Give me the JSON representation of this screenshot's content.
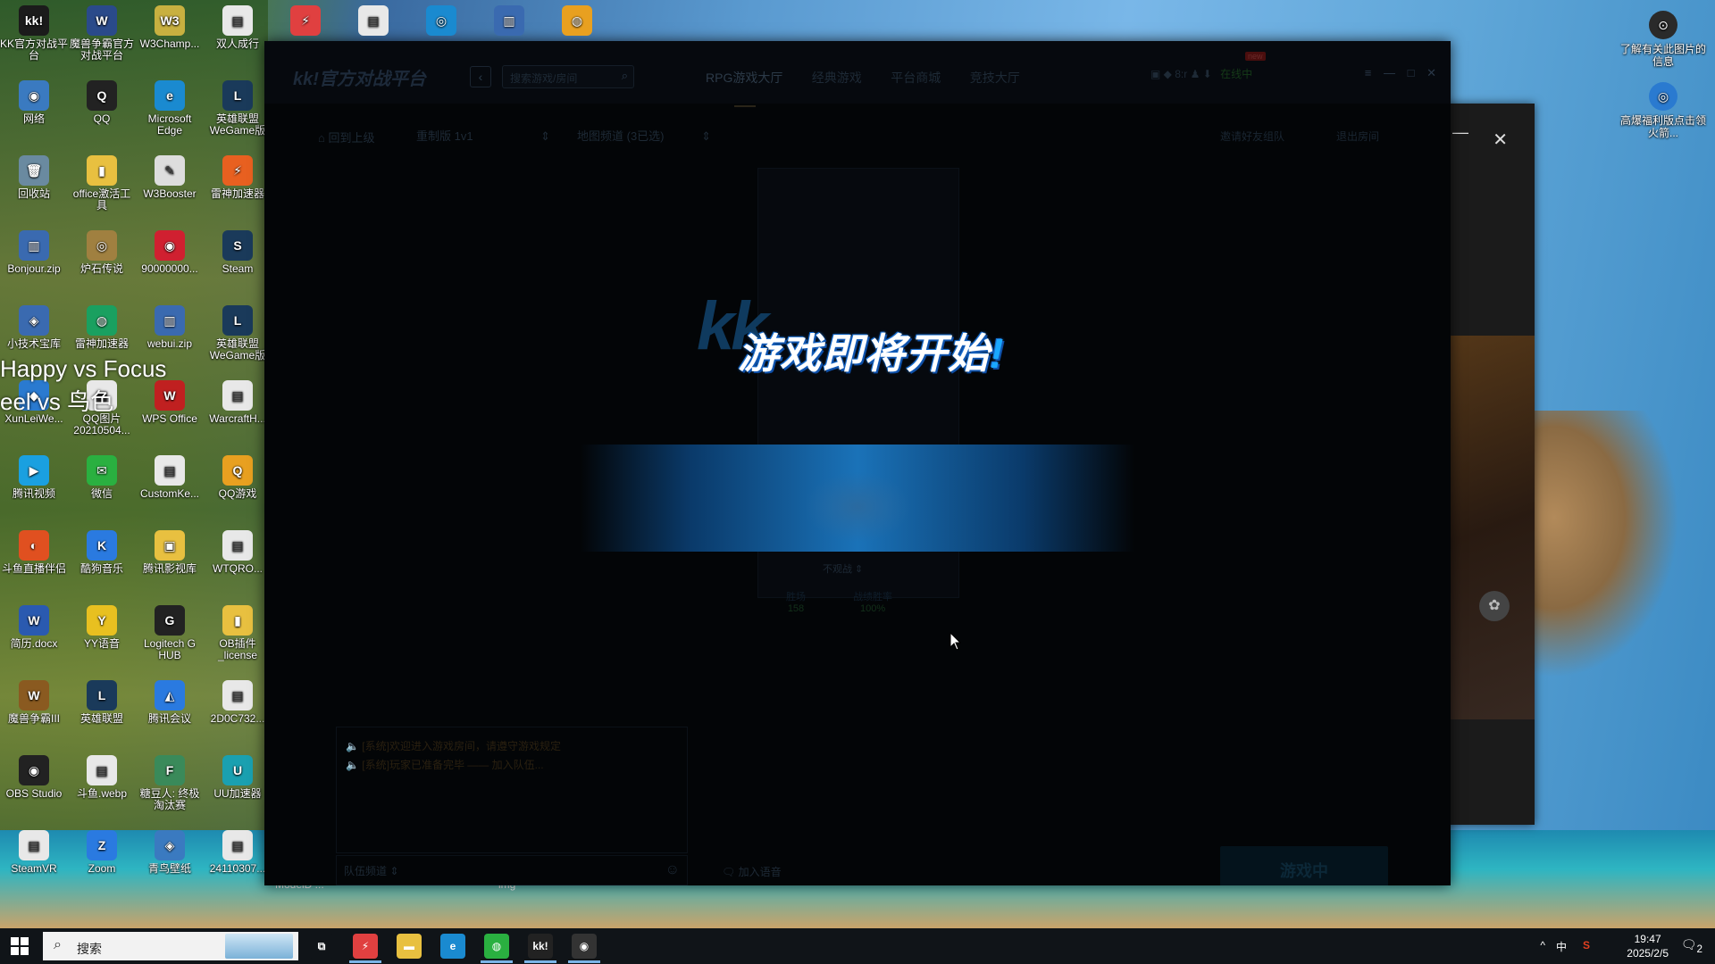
{
  "desktop_icons": [
    {
      "label": "KK官方对战平台",
      "glyph": "kk!",
      "color": "#1b1b1b"
    },
    {
      "label": "魔兽争霸官方对战平台",
      "glyph": "W",
      "color": "#2a4a8a"
    },
    {
      "label": "W3Champ...",
      "glyph": "W3",
      "color": "#c8b040"
    },
    {
      "label": "双人成行",
      "glyph": "▤",
      "color": "#e8e8e8"
    },
    {
      "label": "网络",
      "glyph": "◉",
      "color": "#3a7ac0"
    },
    {
      "label": "QQ",
      "glyph": "Q",
      "color": "#222"
    },
    {
      "label": "Microsoft Edge",
      "glyph": "e",
      "color": "#1a8ad0"
    },
    {
      "label": "英雄联盟WeGame版",
      "glyph": "L",
      "color": "#1a3a5a"
    },
    {
      "label": "回收站",
      "glyph": "🗑",
      "color": "#6a8aa0"
    },
    {
      "label": "office激活工具",
      "glyph": "▮",
      "color": "#e8c040"
    },
    {
      "label": "W3Booster",
      "glyph": "✎",
      "color": "#dddddd"
    },
    {
      "label": "雷神加速器",
      "glyph": "⚡",
      "color": "#e86020"
    },
    {
      "label": "Bonjour.zip",
      "glyph": "▥",
      "color": "#3a6ab0"
    },
    {
      "label": "炉石传说",
      "glyph": "◎",
      "color": "#a08040"
    },
    {
      "label": "90000000...",
      "glyph": "◉",
      "color": "#d02030"
    },
    {
      "label": "Steam",
      "glyph": "S",
      "color": "#1a3a5a"
    },
    {
      "label": "小技术宝库",
      "glyph": "◈",
      "color": "#3a6ab0"
    },
    {
      "label": "雷神加速器",
      "glyph": "◍",
      "color": "#1aa060"
    },
    {
      "label": "webui.zip",
      "glyph": "▥",
      "color": "#3a6ab0"
    },
    {
      "label": "英雄联盟WeGame版",
      "glyph": "L",
      "color": "#1a3a5a"
    },
    {
      "label": "XunLeiWe...",
      "glyph": "◆",
      "color": "#2a7ad0"
    },
    {
      "label": "QQ图片20210504...",
      "glyph": "▦",
      "color": "#e8e8e8"
    },
    {
      "label": "WPS Office",
      "glyph": "W",
      "color": "#c02020"
    },
    {
      "label": "WarcraftH...",
      "glyph": "▤",
      "color": "#e8e8e8"
    },
    {
      "label": "腾讯视频",
      "glyph": "▶",
      "color": "#1aa0e0"
    },
    {
      "label": "微信",
      "glyph": "✉",
      "color": "#2ab040"
    },
    {
      "label": "CustomKe...",
      "glyph": "▤",
      "color": "#e8e8e8"
    },
    {
      "label": "QQ游戏",
      "glyph": "Q",
      "color": "#e8a020"
    },
    {
      "label": "斗鱼直播伴侣",
      "glyph": "◐",
      "color": "#e05020"
    },
    {
      "label": "酷狗音乐",
      "glyph": "K",
      "color": "#2a7ae0"
    },
    {
      "label": "腾讯影视库",
      "glyph": "▣",
      "color": "#e8c040"
    },
    {
      "label": "WTQRO...",
      "glyph": "▤",
      "color": "#e8e8e8"
    },
    {
      "label": "简历.docx",
      "glyph": "W",
      "color": "#2a5ab0"
    },
    {
      "label": "YY语音",
      "glyph": "Y",
      "color": "#e8c020"
    },
    {
      "label": "Logitech G HUB",
      "glyph": "G",
      "color": "#222"
    },
    {
      "label": "OB插件_license",
      "glyph": "▮",
      "color": "#e8c040"
    },
    {
      "label": "魔兽争霸III",
      "glyph": "W",
      "color": "#8a5a20"
    },
    {
      "label": "英雄联盟",
      "glyph": "L",
      "color": "#1a3a5a"
    },
    {
      "label": "腾讯会议",
      "glyph": "◭",
      "color": "#2a7ae0"
    },
    {
      "label": "2D0C732...",
      "glyph": "▤",
      "color": "#e8e8e8"
    },
    {
      "label": "OBS Studio",
      "glyph": "◉",
      "color": "#222"
    },
    {
      "label": "斗鱼.webp",
      "glyph": "▤",
      "color": "#e8e8e8"
    },
    {
      "label": "糖豆人: 终极淘汰赛",
      "glyph": "F",
      "color": "#3a8a5a"
    },
    {
      "label": "UU加速器",
      "glyph": "U",
      "color": "#1aa0b0"
    },
    {
      "label": "SteamVR",
      "glyph": "▤",
      "color": "#e8e8e8"
    },
    {
      "label": "Zoom",
      "glyph": "Z",
      "color": "#2a7ae0"
    },
    {
      "label": "青鸟壁纸",
      "glyph": "◈",
      "color": "#3a7ac0"
    },
    {
      "label": "24110307...",
      "glyph": "▤",
      "color": "#e8e8e8"
    }
  ],
  "top_icons": [
    {
      "glyph": "⚡",
      "color": "#e04040"
    },
    {
      "glyph": "▤",
      "color": "#e8e8e8"
    },
    {
      "glyph": "◎",
      "color": "#1a8ad0"
    },
    {
      "glyph": "▥",
      "color": "#3a6ab0"
    },
    {
      "glyph": "◍",
      "color": "#e8a020"
    }
  ],
  "right_icons": [
    {
      "label": "了解有关此图片的信息",
      "glyph": "⊙"
    },
    {
      "label": "高爆福利版点击领火箭...",
      "glyph": "◎"
    }
  ],
  "overlay_text": {
    "happy": "Happy vs Focus",
    "eel": "eel vs 鸟色",
    "bottom_left": "ModelD ...",
    "bottom_mid": "img"
  },
  "kk_window": {
    "logo": "kk!官方对战平台",
    "search_placeholder": "搜索游戏/房间",
    "nav": [
      "RPG游戏大厅",
      "经典游戏",
      "平台商城",
      "竞技大厅"
    ],
    "user_status": "在线中",
    "new_badge": "new",
    "crumb": "回到上级",
    "mode_select": "重制版 1v1",
    "map_select": "地图频道 (3已选)",
    "right_buttons": [
      "邀请好友组队",
      "退出房间"
    ],
    "slot_dropdown": "不观战",
    "stats": [
      {
        "label": "胜场",
        "value": "158"
      },
      {
        "label": "战绩胜率",
        "value": "100%"
      }
    ],
    "chat_messages": [
      "[系统]欢迎进入游戏房间，请遵守游戏规定",
      "[系统]玩家已准备完毕 —— 加入队伍..."
    ],
    "chat_channel": "队伍频道",
    "voice": "加入语音",
    "playing_button": "游戏中",
    "splash_logo": "kk",
    "splash_text": "游戏即将开始",
    "splash_bang": "!"
  },
  "taskbar": {
    "search_placeholder": "搜索",
    "apps": [
      {
        "name": "task-view",
        "glyph": "⧉",
        "color": "#101418"
      },
      {
        "name": "game",
        "glyph": "⚡",
        "color": "#e04040"
      },
      {
        "name": "file-explorer",
        "glyph": "▬",
        "color": "#e8c040"
      },
      {
        "name": "edge",
        "glyph": "e",
        "color": "#1a8ad0"
      },
      {
        "name": "xbox",
        "glyph": "◍",
        "color": "#2ab040"
      },
      {
        "name": "kk",
        "glyph": "kk!",
        "color": "#222"
      },
      {
        "name": "obs",
        "glyph": "◉",
        "color": "#333"
      }
    ],
    "tray": {
      "ime": "中",
      "chevron": "^",
      "app": "S"
    },
    "time": "19:47",
    "date": "2025/2/5",
    "notifications": "2"
  }
}
